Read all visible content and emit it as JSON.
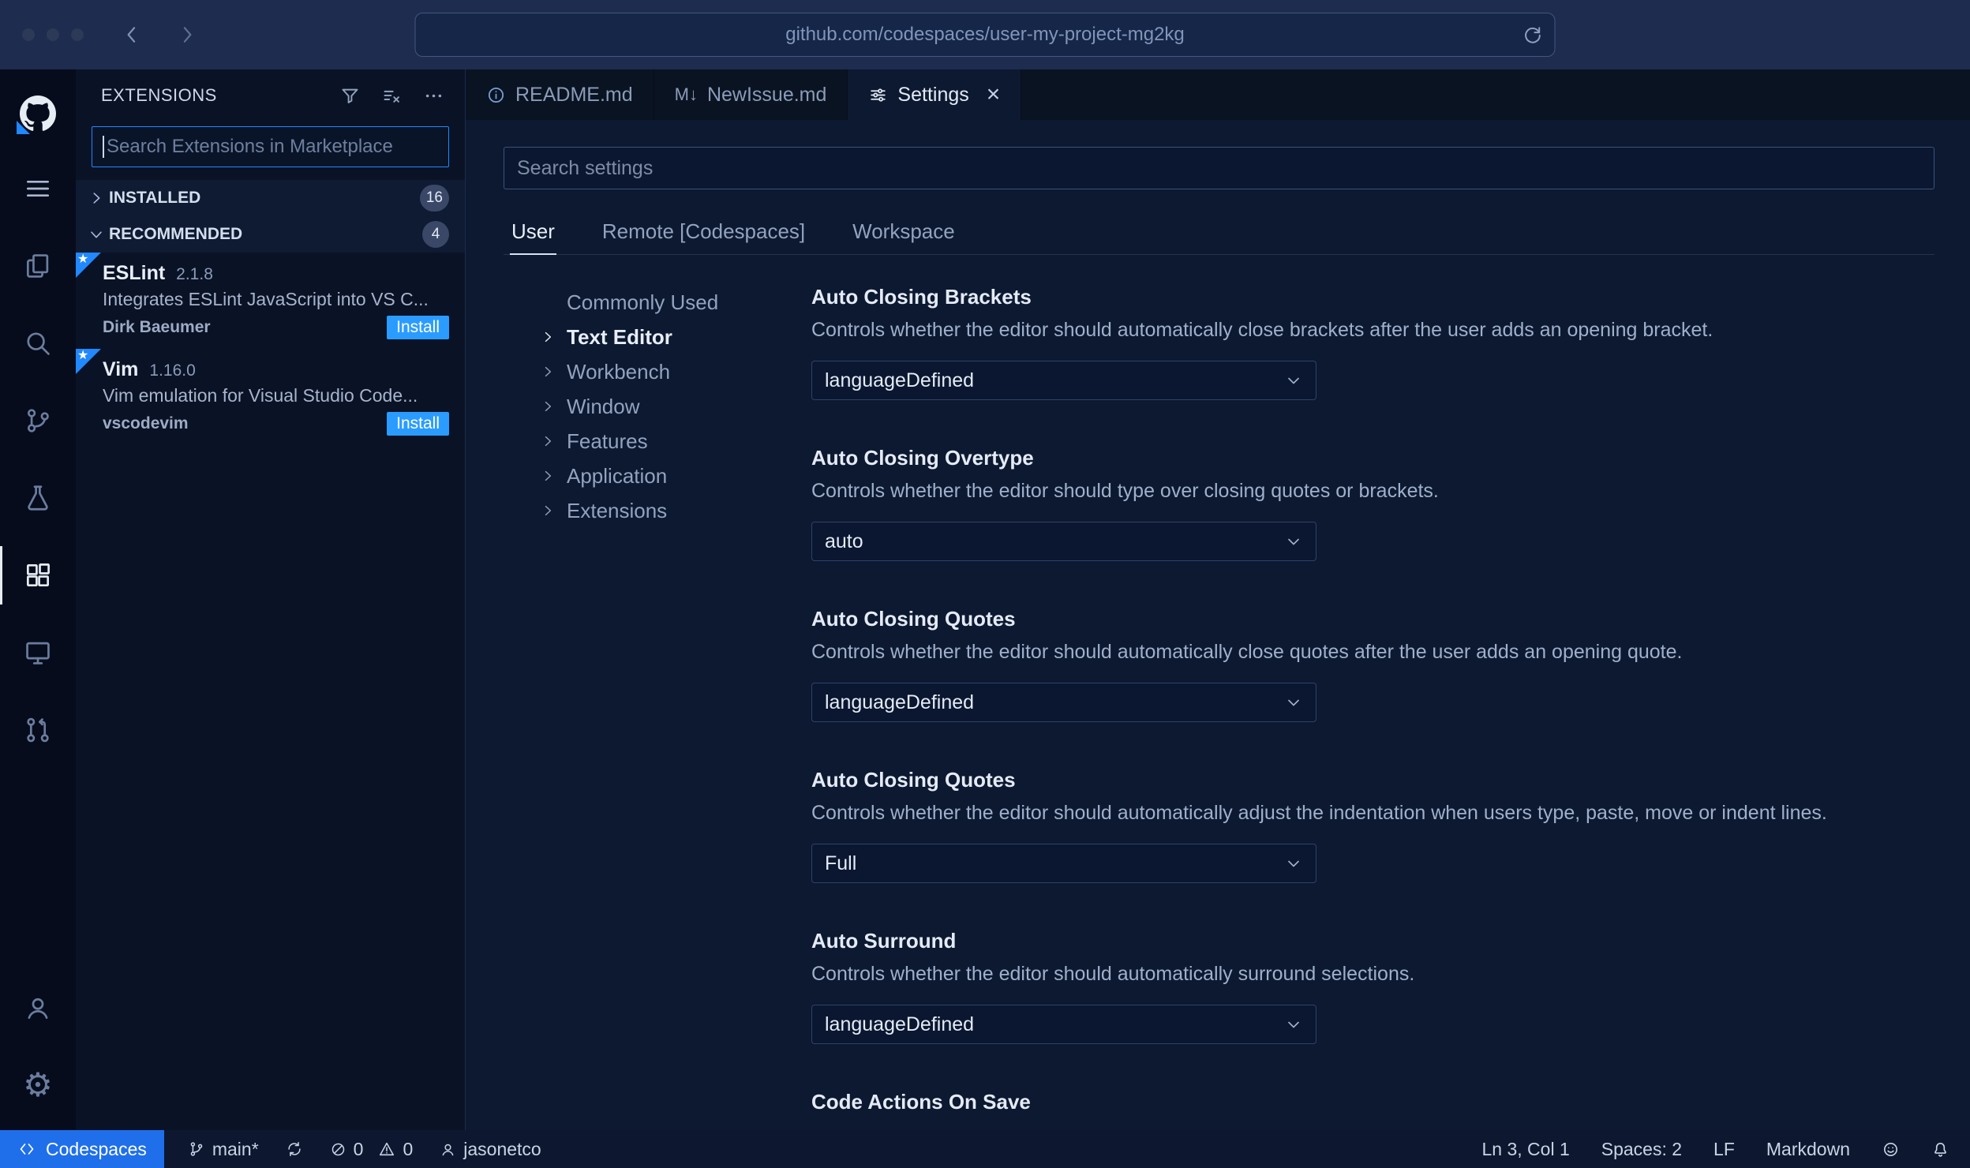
{
  "colors": {
    "accent": "#2188ff",
    "install_button": "#2b9cff",
    "codespaces_blue": "#1f6feb"
  },
  "browser": {
    "url": "github.com/codespaces/user-my-project-mg2kg"
  },
  "sidebar": {
    "title": "EXTENSIONS",
    "search_placeholder": "Search Extensions in Marketplace",
    "sections": [
      {
        "label": "INSTALLED",
        "count": "16"
      },
      {
        "label": "RECOMMENDED",
        "count": "4"
      }
    ],
    "extensions": [
      {
        "name": "ESLint",
        "version": "2.1.8",
        "description": "Integrates ESLint JavaScript into VS C...",
        "author": "Dirk Baeumer",
        "action": "Install",
        "star": "★"
      },
      {
        "name": "Vim",
        "version": "1.16.0",
        "description": "Vim emulation for Visual Studio Code...",
        "author": "vscodevim",
        "action": "Install",
        "star": "★"
      }
    ]
  },
  "editor": {
    "tabs": [
      {
        "label": "README.md"
      },
      {
        "label": "NewIssue.md"
      },
      {
        "label": "Settings"
      }
    ],
    "markdown_glyph": "M↓",
    "close_glyph": "×"
  },
  "settings": {
    "search_placeholder": "Search settings",
    "scopes": [
      {
        "label": "User"
      },
      {
        "label": "Remote [Codespaces]"
      },
      {
        "label": "Workspace"
      }
    ],
    "toc": [
      {
        "label": "Commonly Used"
      },
      {
        "label": "Text Editor"
      },
      {
        "label": "Workbench"
      },
      {
        "label": "Window"
      },
      {
        "label": "Features"
      },
      {
        "label": "Application"
      },
      {
        "label": "Extensions"
      }
    ],
    "items": [
      {
        "title": "Auto Closing Brackets",
        "description": "Controls whether the editor should automatically close brackets after the user adds an opening bracket.",
        "value": "languageDefined"
      },
      {
        "title": "Auto Closing Overtype",
        "description": "Controls whether the editor should type over closing quotes or brackets.",
        "value": "auto"
      },
      {
        "title": "Auto Closing Quotes",
        "description": "Controls whether the editor should automatically close quotes after the user adds an opening quote.",
        "value": "languageDefined"
      },
      {
        "title": "Auto Closing Quotes",
        "description": "Controls whether the editor should automatically adjust the indentation when users type, paste, move or indent lines.",
        "value": "Full"
      },
      {
        "title": "Auto Surround",
        "description": "Controls whether the editor should automatically surround selections.",
        "value": "languageDefined"
      },
      {
        "title": "Code Actions On Save"
      }
    ]
  },
  "status_bar": {
    "codespaces_label": "Codespaces",
    "branch": "main*",
    "error_count": "0",
    "warning_count": "0",
    "username": "jasonetco",
    "cursor_position": "Ln 3, Col 1",
    "indentation": "Spaces: 2",
    "eol": "LF",
    "language": "Markdown"
  }
}
